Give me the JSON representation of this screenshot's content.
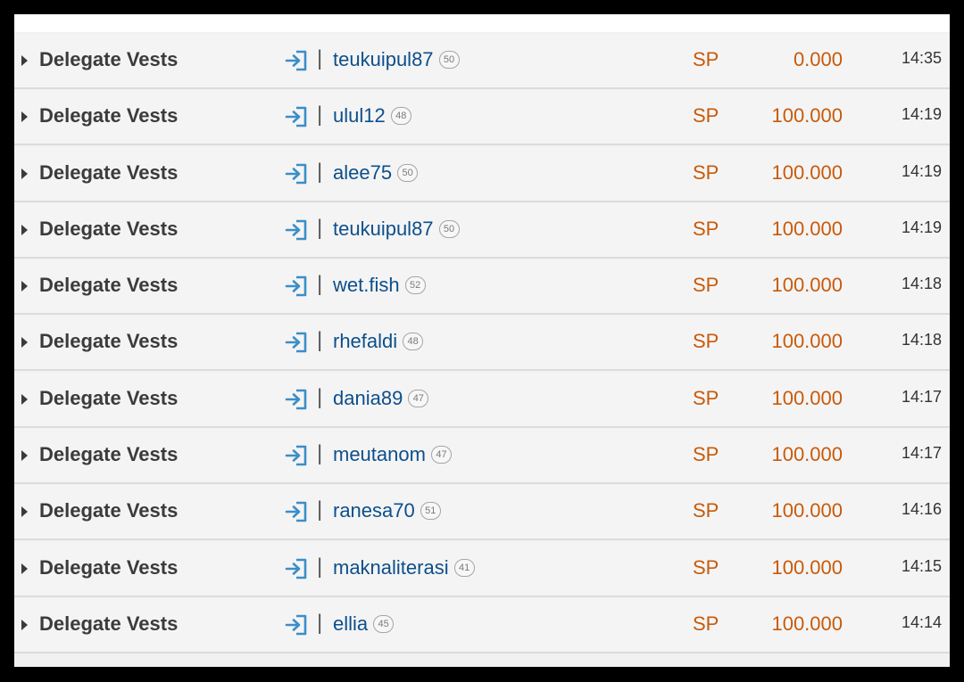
{
  "colors": {
    "operation_text": "#3b3b3b",
    "user_link": "#0d4f8b",
    "amount": "#c85a0a",
    "icon_blue": "#3b8ec8",
    "row_bg": "#f4f4f4"
  },
  "icons": {
    "caret": "caret-right-icon",
    "incoming": "sign-in-icon"
  },
  "rows": [
    {
      "operation": "Delegate Vests",
      "separator": "|",
      "user": "teukuipul87",
      "reputation": "50",
      "unit": "SP",
      "amount": "0.000",
      "time": "14:35"
    },
    {
      "operation": "Delegate Vests",
      "separator": "|",
      "user": "ulul12",
      "reputation": "48",
      "unit": "SP",
      "amount": "100.000",
      "time": "14:19"
    },
    {
      "operation": "Delegate Vests",
      "separator": "|",
      "user": "alee75",
      "reputation": "50",
      "unit": "SP",
      "amount": "100.000",
      "time": "14:19"
    },
    {
      "operation": "Delegate Vests",
      "separator": "|",
      "user": "teukuipul87",
      "reputation": "50",
      "unit": "SP",
      "amount": "100.000",
      "time": "14:19"
    },
    {
      "operation": "Delegate Vests",
      "separator": "|",
      "user": "wet.fish",
      "reputation": "52",
      "unit": "SP",
      "amount": "100.000",
      "time": "14:18"
    },
    {
      "operation": "Delegate Vests",
      "separator": "|",
      "user": "rhefaldi",
      "reputation": "48",
      "unit": "SP",
      "amount": "100.000",
      "time": "14:18"
    },
    {
      "operation": "Delegate Vests",
      "separator": "|",
      "user": "dania89",
      "reputation": "47",
      "unit": "SP",
      "amount": "100.000",
      "time": "14:17"
    },
    {
      "operation": "Delegate Vests",
      "separator": "|",
      "user": "meutanom",
      "reputation": "47",
      "unit": "SP",
      "amount": "100.000",
      "time": "14:17"
    },
    {
      "operation": "Delegate Vests",
      "separator": "|",
      "user": "ranesa70",
      "reputation": "51",
      "unit": "SP",
      "amount": "100.000",
      "time": "14:16"
    },
    {
      "operation": "Delegate Vests",
      "separator": "|",
      "user": "maknaliterasi",
      "reputation": "41",
      "unit": "SP",
      "amount": "100.000",
      "time": "14:15"
    },
    {
      "operation": "Delegate Vests",
      "separator": "|",
      "user": "ellia",
      "reputation": "45",
      "unit": "SP",
      "amount": "100.000",
      "time": "14:14"
    }
  ]
}
